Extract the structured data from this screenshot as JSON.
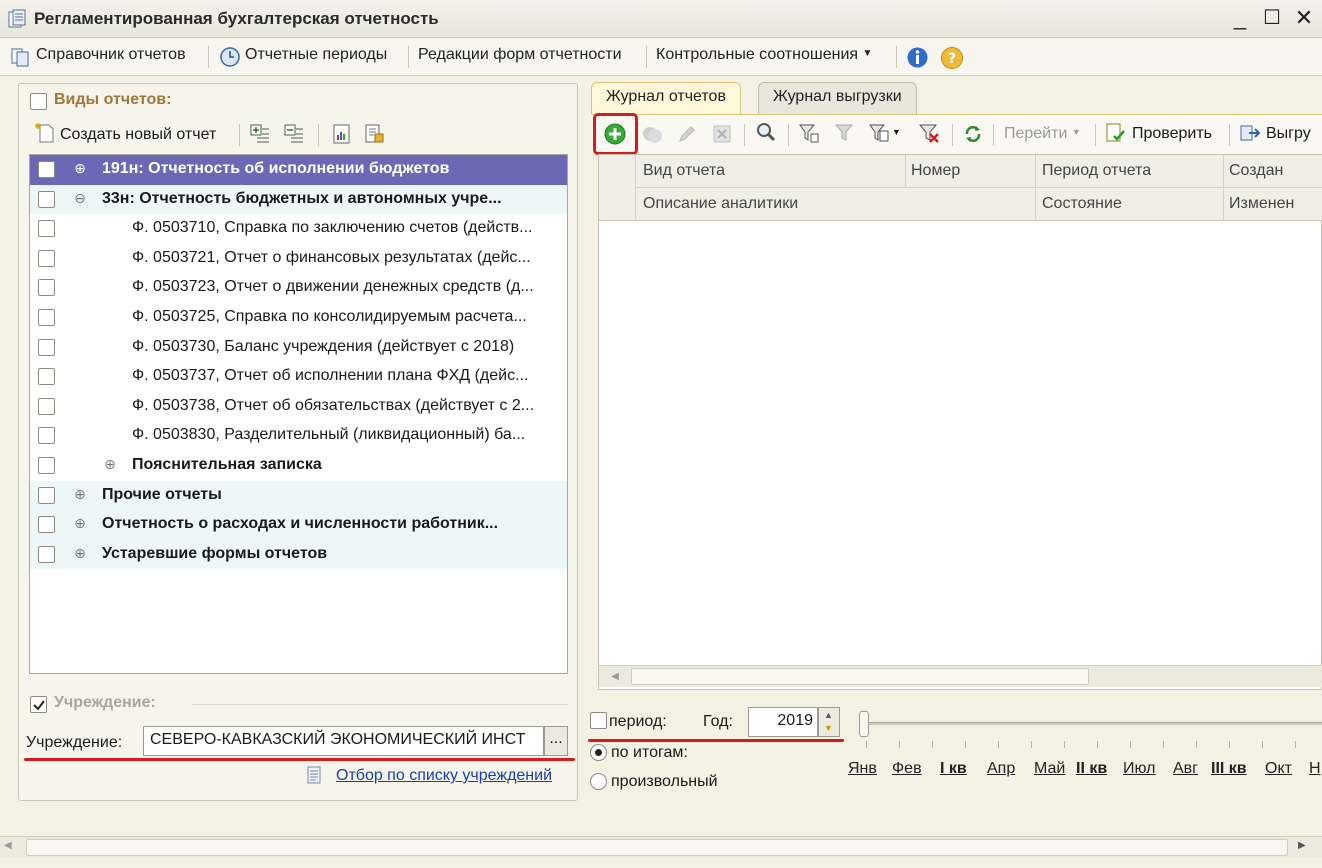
{
  "window": {
    "title": "Регламентированная бухгалтерская отчетность",
    "controls": [
      "_",
      "☐",
      "✕"
    ]
  },
  "toolbar": {
    "items": [
      "Справочник отчетов",
      "Отчетные периоды",
      "Редакции форм отчетности",
      "Контрольные соотношения"
    ]
  },
  "left": {
    "header": "Виды отчетов:",
    "create_button": "Создать новый отчет",
    "tree": [
      {
        "text": "191н: Отчетность об исполнении бюджетов",
        "bold": true,
        "expander": "⊕",
        "level": 0
      },
      {
        "text": "33н: Отчетность бюджетных и автономных учре...",
        "bold": true,
        "expander": "⊖",
        "level": 0
      },
      {
        "text": "Ф. 0503710, Справка по заключению счетов (действ...",
        "bold": false,
        "expander": "",
        "level": 1
      },
      {
        "text": "Ф. 0503721, Отчет о финансовых результатах (дейс...",
        "bold": false,
        "expander": "",
        "level": 1
      },
      {
        "text": "Ф. 0503723, Отчет о движении денежных средств (д...",
        "bold": false,
        "expander": "",
        "level": 1
      },
      {
        "text": "Ф. 0503725, Справка по консолидируемым расчета...",
        "bold": false,
        "expander": "",
        "level": 1
      },
      {
        "text": "Ф. 0503730, Баланс учреждения (действует с 2018)",
        "bold": false,
        "expander": "",
        "level": 1
      },
      {
        "text": "Ф. 0503737, Отчет об исполнении плана ФХД (дейс...",
        "bold": false,
        "expander": "",
        "level": 1
      },
      {
        "text": "Ф. 0503738, Отчет об обязательствах (действует с 2...",
        "bold": false,
        "expander": "",
        "level": 1
      },
      {
        "text": "Ф. 0503830, Разделительный (ликвидационный) ба...",
        "bold": false,
        "expander": "",
        "level": 1
      },
      {
        "text": "Пояснительная записка",
        "bold": true,
        "expander": "⊕",
        "level": 1
      },
      {
        "text": "Прочие отчеты",
        "bold": true,
        "expander": "⊕",
        "level": 0
      },
      {
        "text": "Отчетность о расходах и численности работник...",
        "bold": true,
        "expander": "⊕",
        "level": 0
      },
      {
        "text": "Устаревшие формы отчетов",
        "bold": true,
        "expander": "⊕",
        "level": 0
      }
    ],
    "institution_checkbox_label": "Учреждение:",
    "institution_label": "Учреждение:",
    "institution_value": "СЕВЕРО-КАВКАЗСКИЙ ЭКОНОМИЧЕСКИЙ ИНСТ",
    "institution_button": "...",
    "filter_link": "Отбор по списку учреждений"
  },
  "right": {
    "tabs": [
      "Журнал отчетов",
      "Журнал выгрузки"
    ],
    "grid_toolbar": {
      "goto": "Перейти",
      "check": "Проверить",
      "export": "Выгру"
    },
    "columns_row1": [
      "Вид отчета",
      "Номер",
      "Период отчета",
      "Создан"
    ],
    "columns_row2": [
      "Описание аналитики",
      "Состояние",
      "Изменен"
    ]
  },
  "period": {
    "checkbox_label": "период:",
    "year_label": "Год:",
    "year_value": "2019",
    "radio_totals": "по итогам:",
    "radio_custom": "произвольный",
    "months": [
      {
        "label": "Янв",
        "bold": false
      },
      {
        "label": "Фев",
        "bold": false
      },
      {
        "label": "I кв",
        "bold": true
      },
      {
        "label": "Апр",
        "bold": false
      },
      {
        "label": "Май",
        "bold": false
      },
      {
        "label": "II кв",
        "bold": true
      },
      {
        "label": "Июл",
        "bold": false
      },
      {
        "label": "Авг",
        "bold": false
      },
      {
        "label": "III кв",
        "bold": true
      },
      {
        "label": "Окт",
        "bold": false
      },
      {
        "label": "Н",
        "bold": false
      }
    ]
  }
}
